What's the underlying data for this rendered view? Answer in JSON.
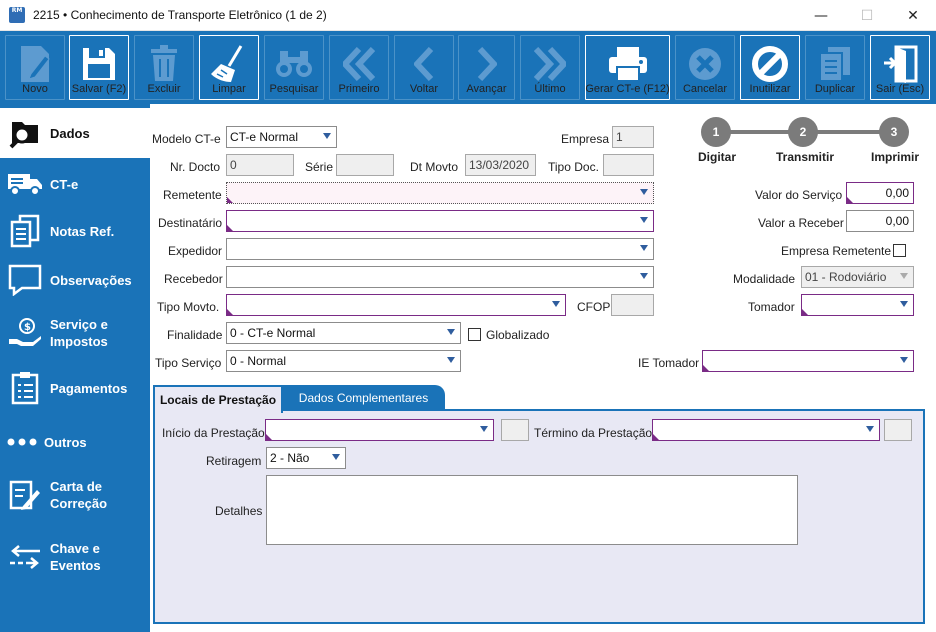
{
  "window": {
    "title": "2215 • Conhecimento de Transporte Eletrônico (1 de 2)",
    "app_icon_text": "RM"
  },
  "toolbar": {
    "novo": "Novo",
    "salvar": "Salvar (F2)",
    "excluir": "Excluir",
    "limpar": "Limpar",
    "pesquisar": "Pesquisar",
    "primeiro": "Primeiro",
    "voltar": "Voltar",
    "avancar": "Avançar",
    "ultimo": "Último",
    "gerar": "Gerar CT-e (F12)",
    "cancelar": "Cancelar",
    "inutilizar": "Inutilizar",
    "duplicar": "Duplicar",
    "sair": "Sair (Esc)"
  },
  "sidebar": {
    "dados": "Dados",
    "cte": "CT-e",
    "notas": "Notas Ref.",
    "observacoes": "Observações",
    "servico_1": "Serviço e",
    "servico_2": "Impostos",
    "pagamentos": "Pagamentos",
    "outros": "Outros",
    "carta_1": "Carta de",
    "carta_2": "Correção",
    "chave_1": "Chave e",
    "chave_2": "Eventos"
  },
  "form": {
    "modelo_label": "Modelo CT-e",
    "modelo_value": "CT-e Normal",
    "empresa_label": "Empresa",
    "empresa_value": "1",
    "nr_docto_label": "Nr. Docto",
    "nr_docto_value": "0",
    "serie_label": "Série",
    "serie_value": "",
    "dt_movto_label": "Dt Movto",
    "dt_movto_value": "13/03/2020",
    "tipo_doc_label": "Tipo Doc.",
    "tipo_doc_value": "",
    "remetente_label": "Remetente",
    "destinatario_label": "Destinatário",
    "expedidor_label": "Expedidor",
    "recebedor_label": "Recebedor",
    "tipo_movto_label": "Tipo Movto.",
    "cfop_label": "CFOP",
    "finalidade_label": "Finalidade",
    "finalidade_value": "0 - CT-e Normal",
    "globalizado_label": "Globalizado",
    "tipo_servico_label": "Tipo Serviço",
    "tipo_servico_value": "0 - Normal",
    "valor_servico_label": "Valor do Serviço",
    "valor_servico_value": "0,00",
    "valor_receber_label": "Valor a Receber",
    "valor_receber_value": "0,00",
    "empresa_remetente_label": "Empresa Remetente",
    "modalidade_label": "Modalidade",
    "modalidade_value": "01 - Rodoviário",
    "tomador_label": "Tomador",
    "ie_tomador_label": "IE Tomador"
  },
  "steps": {
    "s1_num": "1",
    "s1": "Digitar",
    "s2_num": "2",
    "s2": "Transmitir",
    "s3_num": "3",
    "s3": "Imprimir"
  },
  "tabs": {
    "locais": "Locais de Prestação",
    "dados_compl": "Dados Complementares"
  },
  "locais": {
    "inicio_label": "Início da Prestação",
    "termino_label": "Término da Prestação",
    "retiragem_label": "Retiragem",
    "retiragem_value": "2 - Não",
    "detalhes_label": "Detalhes"
  },
  "colors": {
    "primary": "#1a73b8",
    "required": "#7a2b86",
    "step": "#7b7b7b"
  }
}
